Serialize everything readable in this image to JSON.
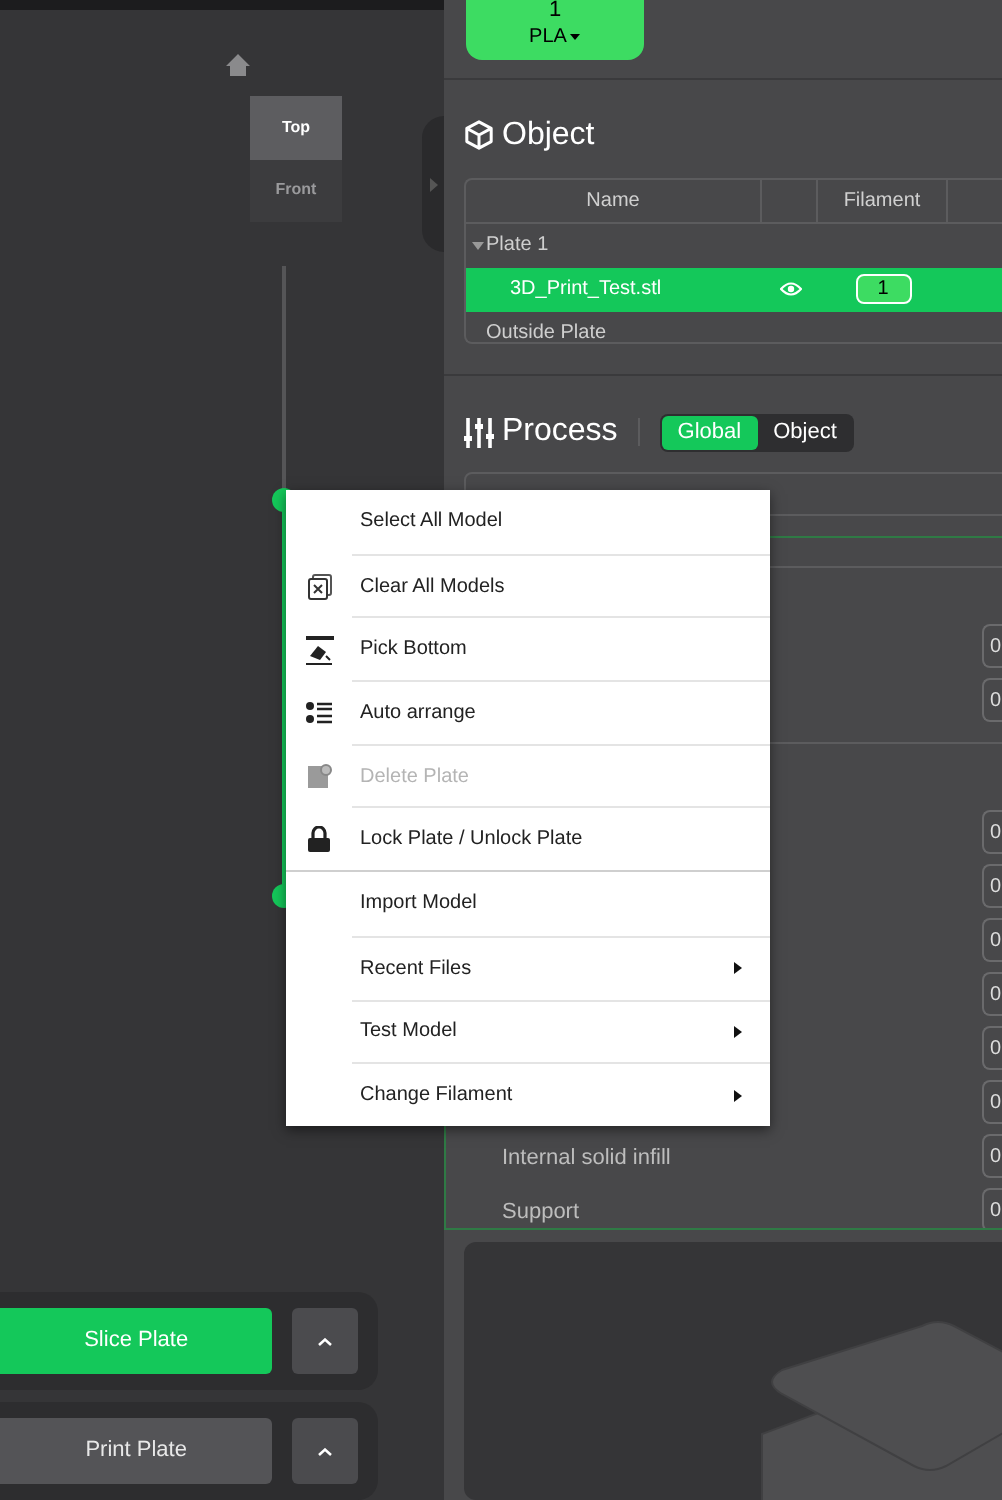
{
  "view_buttons": [
    {
      "label": "Top",
      "selected": true
    },
    {
      "label": "Front",
      "selected": false
    }
  ],
  "layer_slider": {
    "level": 0.62
  },
  "filament": {
    "number": "1",
    "type": "PLA"
  },
  "object_panel": {
    "title": "Object",
    "columns": {
      "name": "Name",
      "filament": "Filament"
    },
    "rows": [
      {
        "kind": "group",
        "name": "Plate 1",
        "expanded": true,
        "selected": false
      },
      {
        "kind": "object",
        "name": "3D_Print_Test.stl",
        "visible": true,
        "filament": "1",
        "selected": true
      },
      {
        "kind": "plain",
        "name": "Outside Plate",
        "selected": false
      }
    ]
  },
  "process_panel": {
    "title": "Process",
    "tabs": [
      {
        "label": "Global",
        "selected": true
      },
      {
        "label": "Object",
        "selected": false
      }
    ],
    "groups": [
      {
        "rows": [
          {
            "value": "0"
          },
          {
            "value": "0"
          }
        ]
      },
      {
        "rows": [
          {
            "value": "0"
          },
          {
            "value": "0"
          },
          {
            "value": "0"
          },
          {
            "value": "0"
          },
          {
            "value": "0"
          },
          {
            "value": "0"
          },
          {
            "label": "Internal solid infill",
            "value": "0"
          },
          {
            "label": "Support",
            "value": "0"
          }
        ]
      }
    ]
  },
  "actions": [
    {
      "kind": "primary",
      "label": "Slice Plate"
    },
    {
      "kind": "secondary",
      "label": "Print Plate"
    }
  ],
  "context_menu": {
    "sections": [
      [
        {
          "label": "Select All Model",
          "kind": "plain",
          "disabled": false,
          "submenu": false
        },
        {
          "label": "Clear All Models",
          "kind": "icon",
          "disabled": false,
          "submenu": false
        },
        {
          "label": "Pick Bottom",
          "kind": "icon",
          "disabled": false,
          "submenu": false
        },
        {
          "label": "Auto arrange",
          "kind": "icon",
          "disabled": false,
          "submenu": false
        },
        {
          "label": "Delete Plate",
          "kind": "icon",
          "disabled": true,
          "submenu": false
        },
        {
          "label": "Lock Plate / Unlock Plate",
          "kind": "icon",
          "disabled": false,
          "submenu": false
        }
      ],
      [
        {
          "label": "Import Model",
          "kind": "plain",
          "disabled": false,
          "submenu": false
        },
        {
          "label": "Recent Files",
          "kind": "plain",
          "disabled": false,
          "submenu": true
        },
        {
          "label": "Test Model",
          "kind": "plain",
          "disabled": false,
          "submenu": true
        },
        {
          "label": "Change Filament",
          "kind": "plain",
          "disabled": false,
          "submenu": true
        }
      ]
    ]
  }
}
